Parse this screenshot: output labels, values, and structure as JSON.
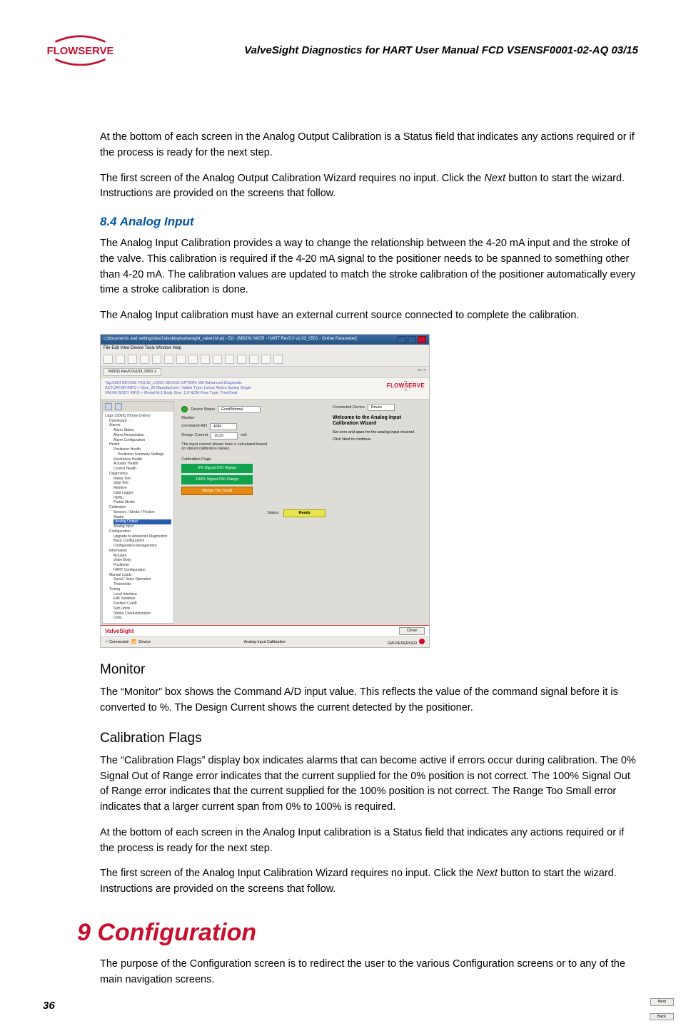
{
  "header": {
    "title": "ValveSight Diagnostics for HART User Manual FCD VSENSF0001-02-AQ 03/15",
    "logo_text": "FLOWSERVE"
  },
  "paragraphs": {
    "p1": "At the bottom of each screen in the Analog Output Calibration is a Status field that indicates any actions required or if the process is ready for the next step.",
    "p2a": "The first screen of the Analog Output Calibration Wizard requires no input. Click the ",
    "p2_next": "Next",
    "p2b": " button to start the wizard. Instructions are provided on the screens that follow.",
    "p3": "The Analog Input Calibration provides a way to change the relationship between the 4-20 mA input and the stroke of the valve. This calibration is required if the 4-20 mA signal to the positioner needs to be spanned to something other than 4-20 mA. The calibration values are updated to match the stroke calibration of the positioner automatically every time a stroke calibration is done.",
    "p4": "The Analog Input calibration must have an external current source connected to complete the calibration.",
    "p5": "The “Monitor” box shows the Command A/D input value. This reflects the value of the command signal before it is converted to %. The Design Current shows the current detected by the positioner.",
    "p6": "The “Calibration Flags” display box indicates alarms that can become active if errors occur during calibration. The 0% Signal Out of Range error indicates that the current supplied for the 0% position is not correct. The 100% Signal Out of Range error indicates that the current supplied for the 100% position is not correct. The Range Too Small error indicates that a larger current span from 0% to 100% is required.",
    "p7": "At the bottom of each screen in the Analog Input calibration is a Status field that indicates any actions required or if the process is ready for the next step.",
    "p8a": "The first screen of the Analog Input Calibration Wizard requires no input. Click the ",
    "p8_next": "Next",
    "p8b": " button to start the wizard. Instructions are provided on the screens that follow.",
    "p9": "The purpose of the Configuration screen is to redirect the user to the various Configuration screens or to any of the main navigation screens."
  },
  "headings": {
    "h84": "8.4  Analog Input",
    "monitor": "Monitor",
    "calflags": "Calibration Flags",
    "config": "9  Configuration"
  },
  "page_number": "36",
  "screenshot": {
    "titlebar": "c:\\documents and settings\\test1\\desktop\\valvesight_valve1M.prj - Ed - [MD201 M/CR - HART Rev5.0 v1.03_0501 - Online Parameter]",
    "menubar": "File  Edit  View  Device  Tools  Window  Help",
    "tab": "M0011 Rev5.0v103_0501 x",
    "info_line1": "Tag:0304    DEVICE TAG:ID_LOGO    DEVICE OPTION: MD Advanced Diagnostic",
    "info_line2": "ACTUATOR INFO > Size_25  Manufacturer: Valtek  Type: Linear Action  Spring Single",
    "info_line3": "VALVE BODY INFO > Model M-1  Body Size: 1.0 NOM  Flow Type: Trim/Seat",
    "logo_text": "FLOWSERVE",
    "tree": {
      "root": "Logix 3200IQ (Home Online)",
      "items": [
        {
          "lvl": 1,
          "txt": "Dashboard"
        },
        {
          "lvl": 1,
          "txt": "Alarms"
        },
        {
          "lvl": 2,
          "txt": "Alarm Status"
        },
        {
          "lvl": 2,
          "txt": "Alarm Annunciation"
        },
        {
          "lvl": 2,
          "txt": "Alarm Configuration"
        },
        {
          "lvl": 1,
          "txt": "Health"
        },
        {
          "lvl": 2,
          "txt": "Positioner Health"
        },
        {
          "lvl": 3,
          "txt": "Positioner Summary Settings"
        },
        {
          "lvl": 2,
          "txt": "Electronics Health"
        },
        {
          "lvl": 2,
          "txt": "Actuator Health"
        },
        {
          "lvl": 2,
          "txt": "Control Health"
        },
        {
          "lvl": 1,
          "txt": "Diagnostics"
        },
        {
          "lvl": 2,
          "txt": "Ramp Test"
        },
        {
          "lvl": 2,
          "txt": "Step Test"
        },
        {
          "lvl": 2,
          "txt": "Retrieve"
        },
        {
          "lvl": 2,
          "txt": "Data Logger"
        },
        {
          "lvl": 2,
          "txt": "HDRL"
        },
        {
          "lvl": 2,
          "txt": "Partial Stroke"
        },
        {
          "lvl": 1,
          "txt": "Calibration"
        },
        {
          "lvl": 2,
          "txt": "Sensors / Stroke / Friction"
        },
        {
          "lvl": 2,
          "txt": "Stroke"
        },
        {
          "lvl": 2,
          "txt": "Analog Output",
          "sel": true
        },
        {
          "lvl": 2,
          "txt": "Analog Input"
        },
        {
          "lvl": 1,
          "txt": "Configuration"
        },
        {
          "lvl": 2,
          "txt": "Upgrade to Advanced Diagnostics"
        },
        {
          "lvl": 2,
          "txt": "Basic Configuration"
        },
        {
          "lvl": 2,
          "txt": "Configuration Management"
        },
        {
          "lvl": 1,
          "txt": "Information"
        },
        {
          "lvl": 2,
          "txt": "Actuator"
        },
        {
          "lvl": 2,
          "txt": "Valve Body"
        },
        {
          "lvl": 2,
          "txt": "Positioner"
        },
        {
          "lvl": 2,
          "txt": "HART Configuration"
        },
        {
          "lvl": 1,
          "txt": "Manual Loads"
        },
        {
          "lvl": 2,
          "txt": "Spool / Valve Operation"
        },
        {
          "lvl": 2,
          "txt": "Thresholds"
        },
        {
          "lvl": 1,
          "txt": "Tuning"
        },
        {
          "lvl": 2,
          "txt": "Local Interface"
        },
        {
          "lvl": 2,
          "txt": "Edit Variables"
        },
        {
          "lvl": 2,
          "txt": "Position Cutoff"
        },
        {
          "lvl": 2,
          "txt": "Soft Limits"
        },
        {
          "lvl": 2,
          "txt": "Stroke Characterization"
        },
        {
          "lvl": 2,
          "txt": "Units"
        }
      ]
    },
    "center": {
      "device_status_label": "Device Status",
      "device_status_value": "Good/Normal",
      "monitor_label": "Monitor",
      "command_ad_label": "Command A/D",
      "command_ad_value": "4096",
      "design_current_label": "Design Current",
      "design_current_value": "10.23",
      "design_current_unit": "mA",
      "note": "The input current shown here is calculated based on stored calibration values.",
      "calflags_label": "Calibration Flags",
      "flag0": "0% Signal O/O Range",
      "flag100": "100% Signal O/O Range",
      "flag_small": "Range Too Small"
    },
    "right": {
      "connected_label": "Connected Device",
      "connected_value": "Device",
      "wizard_title": "Welcome to the Analog Input Calibration Wizard",
      "wizard_text1": "Set zero and span for the analog input channel.",
      "wizard_text2": "Click Next to continue.",
      "next_btn": "Next",
      "back_btn": "Back",
      "status_label": "Status:",
      "status_value": "Ready"
    },
    "brand": "ValveSight",
    "brand_close": "Close",
    "bottom": {
      "left1": "Connected",
      "left2": "Device",
      "mid": "Analog Input Calibration",
      "right": "GW-RESERVED"
    }
  }
}
